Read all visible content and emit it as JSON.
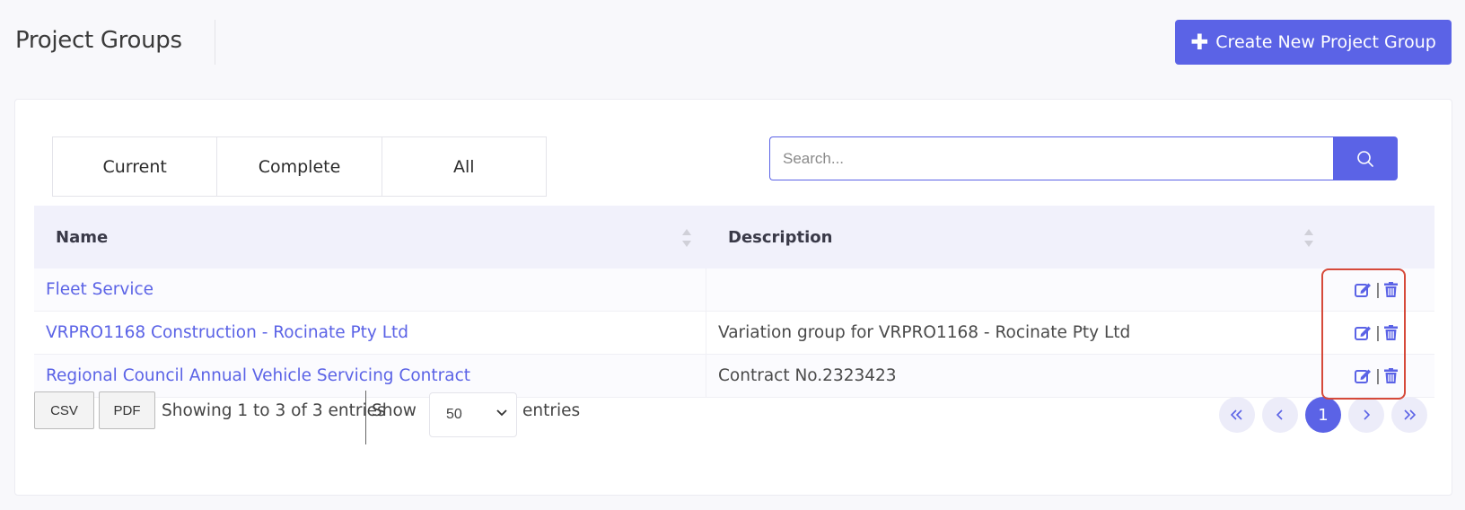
{
  "header": {
    "title": "Project Groups",
    "create_button_label": "Create New Project Group"
  },
  "filters": {
    "tabs": [
      {
        "label": "Current"
      },
      {
        "label": "Complete"
      },
      {
        "label": "All"
      }
    ]
  },
  "search": {
    "placeholder": "Search...",
    "value": ""
  },
  "table": {
    "columns": [
      {
        "label": "Name",
        "sortable": true
      },
      {
        "label": "Description",
        "sortable": true
      },
      {
        "label": "",
        "sortable": false
      }
    ],
    "rows": [
      {
        "name": "Fleet Service",
        "description": ""
      },
      {
        "name": "VRPRO1168 Construction - Rocinate Pty Ltd",
        "description": "Variation group for VRPRO1168 - Rocinate Pty Ltd"
      },
      {
        "name": "Regional Council Annual Vehicle Servicing Contract",
        "description": "Contract No.2323423"
      }
    ],
    "row_action_icons": [
      "edit-icon",
      "trash-icon"
    ],
    "action_separator": "|"
  },
  "footer": {
    "csv_label": "CSV",
    "pdf_label": "PDF",
    "showing_text": "Showing 1 to 3 of 3 entries",
    "show_label": "Show",
    "page_size": "50",
    "entries_label": "entries"
  },
  "pagination": {
    "first_icon": "double-chevron-left-icon",
    "prev_icon": "chevron-left-icon",
    "current_page": "1",
    "next_icon": "chevron-right-icon",
    "last_icon": "double-chevron-right-icon"
  },
  "colors": {
    "accent": "#5b63e6",
    "highlight": "#d64a3a",
    "header_bg": "#f1f1fb"
  }
}
